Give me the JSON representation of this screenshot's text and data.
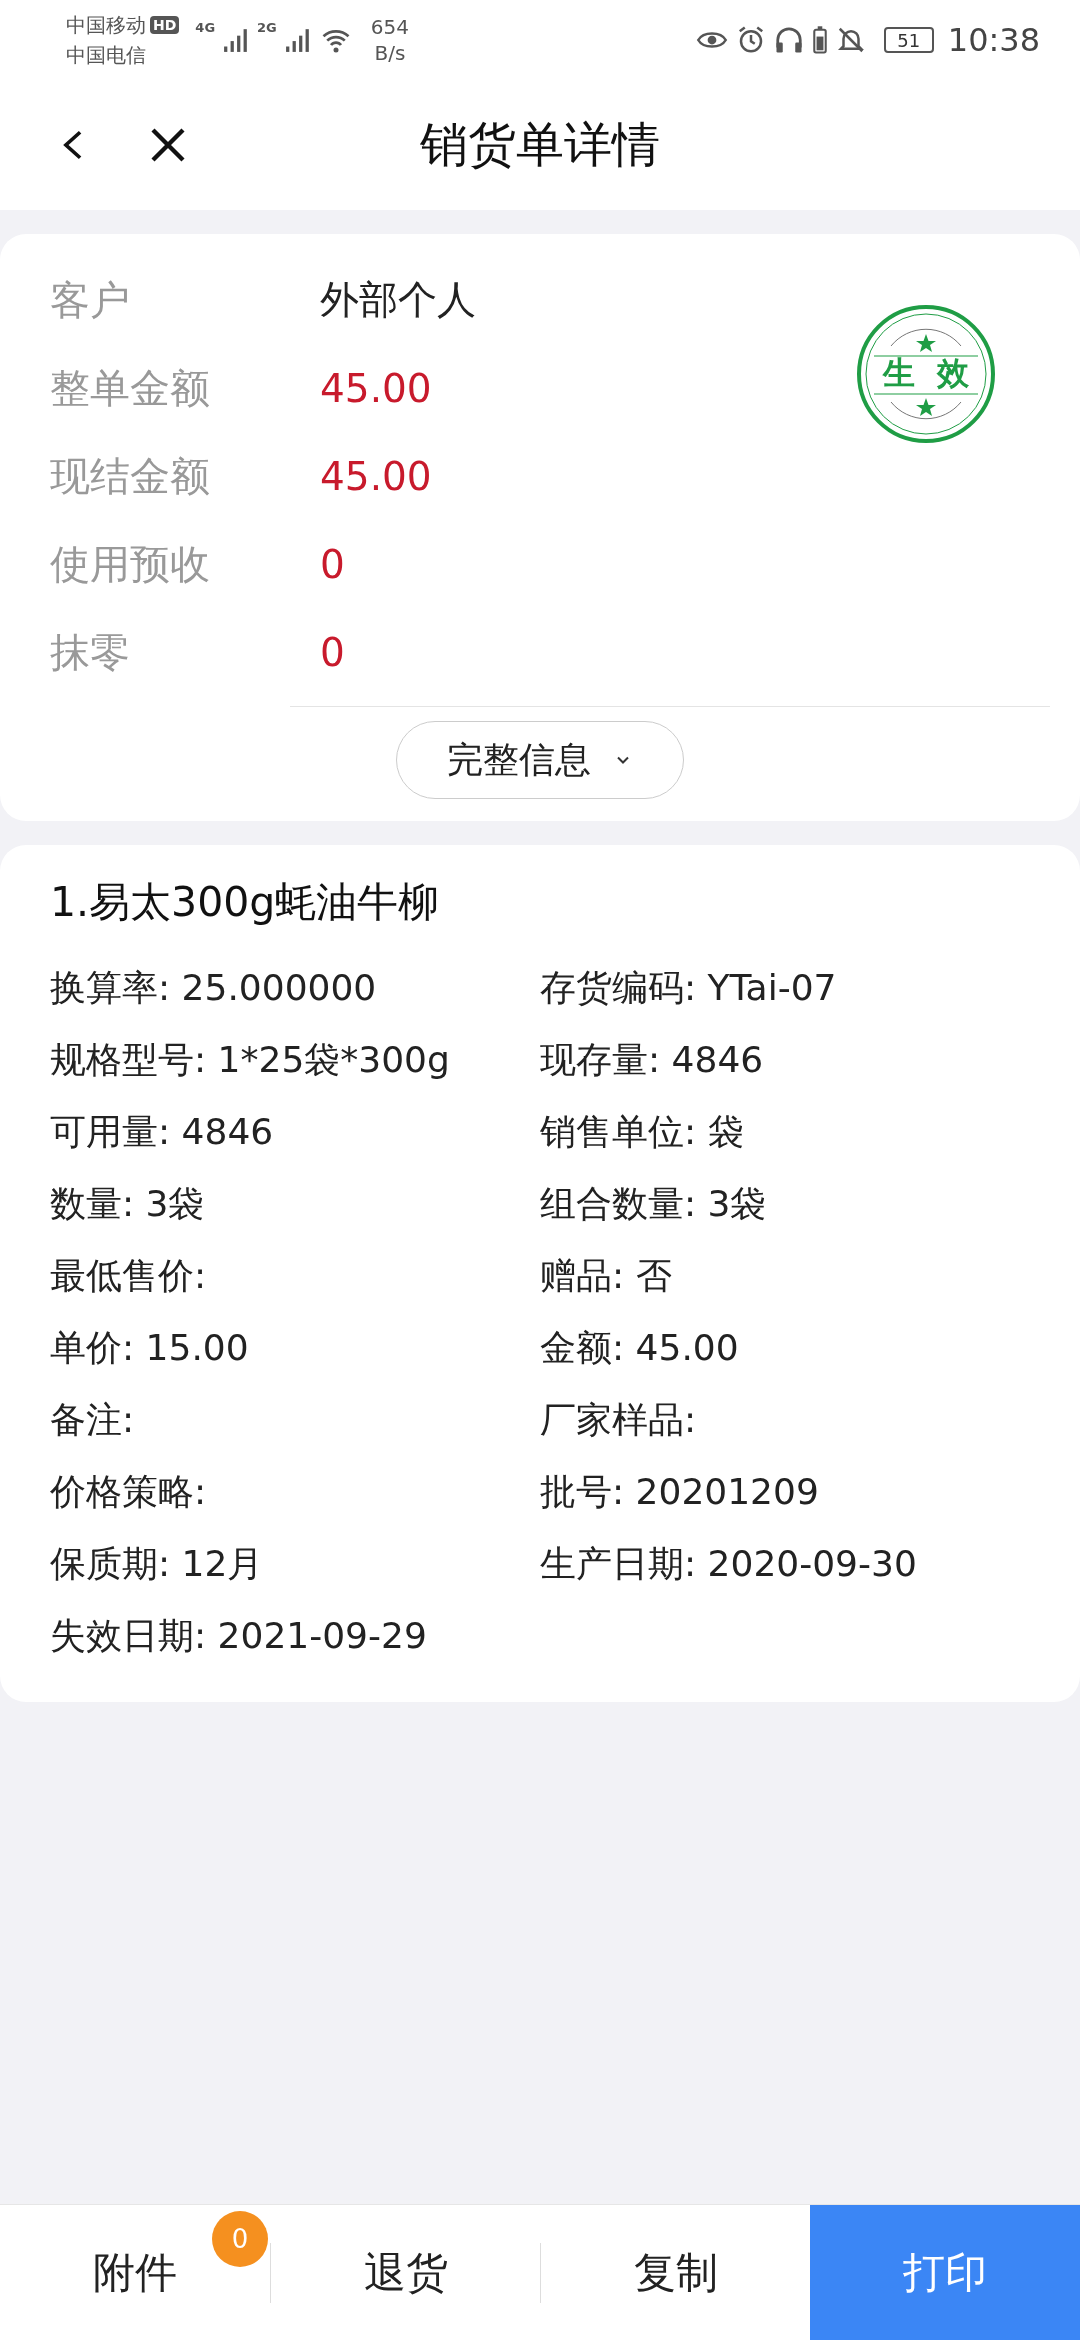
{
  "status_bar": {
    "carrier_1": "中国移动",
    "hd": "HD",
    "carrier_2": "中国电信",
    "net_1": "4G",
    "net_2": "2G",
    "speed": "654",
    "speed_unit": "B/s",
    "battery": "51",
    "time": "10:38"
  },
  "header": {
    "title": "销货单详情"
  },
  "summary": {
    "rows": [
      {
        "label": "客户",
        "value": "外部个人",
        "kind": "plain"
      },
      {
        "label": "整单金额",
        "value": "45.00",
        "kind": "amount"
      },
      {
        "label": "现结金额",
        "value": "45.00",
        "kind": "amount"
      },
      {
        "label": "使用预收",
        "value": "0",
        "kind": "amount"
      },
      {
        "label": "抹零",
        "value": "0",
        "kind": "amount"
      }
    ],
    "stamp": "生效",
    "more_button": "完整信息",
    "expanded": false
  },
  "item": {
    "title": "1.易太300g蚝油牛柳",
    "fields": [
      "换算率: 25.000000",
      "存货编码: YTai-07",
      "规格型号: 1*25袋*300g",
      "现存量: 4846",
      "可用量: 4846",
      "销售单位: 袋",
      "数量: 3袋",
      "组合数量: 3袋",
      "最低售价:",
      "赠品: 否",
      "单价: 15.00",
      "金额: 45.00",
      "备注:",
      "厂家样品:",
      "价格策略:",
      "批号: 20201209",
      "保质期: 12月",
      "生产日期: 2020-09-30",
      "失效日期: 2021-09-29"
    ]
  },
  "bottom_bar": {
    "buttons": [
      {
        "label": "附件",
        "badge": "0",
        "kind": "plain"
      },
      {
        "label": "退货",
        "kind": "plain"
      },
      {
        "label": "复制",
        "kind": "plain"
      },
      {
        "label": "打印",
        "kind": "primary"
      }
    ]
  }
}
